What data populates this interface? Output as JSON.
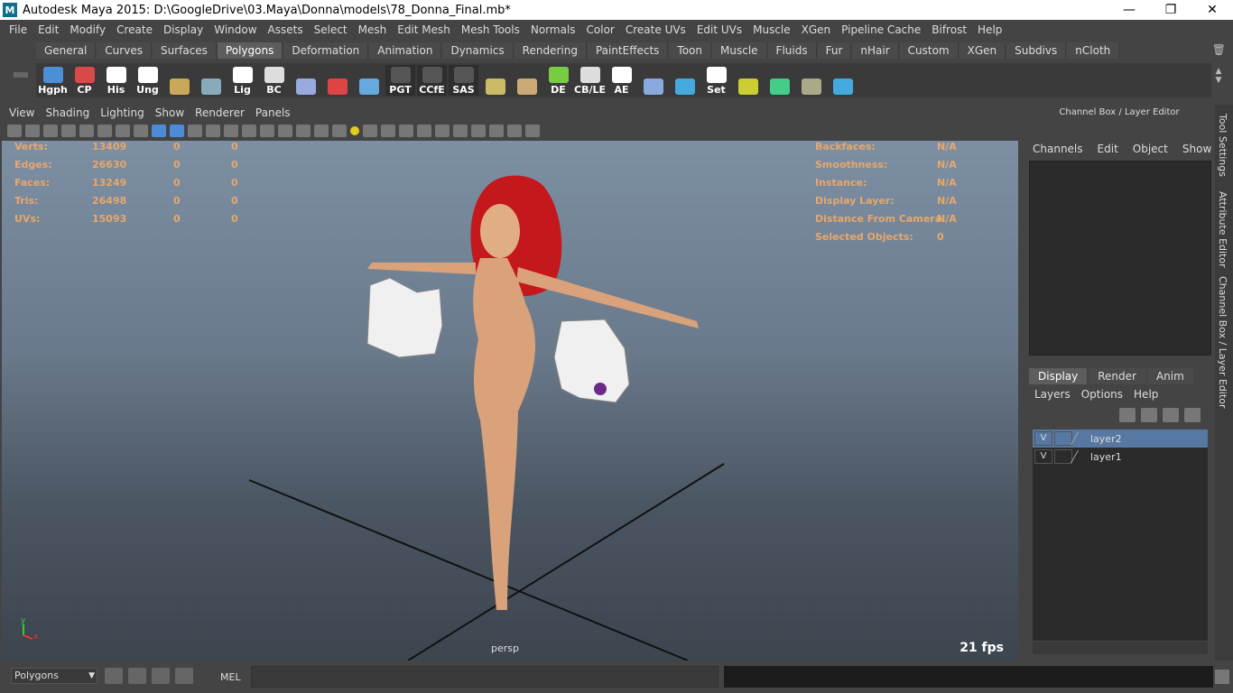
{
  "window": {
    "title": "Autodesk Maya 2015: D:\\GoogleDrive\\03.Maya\\Donna\\models\\78_Donna_Final.mb*",
    "logo": "M"
  },
  "menubar": [
    "File",
    "Edit",
    "Modify",
    "Create",
    "Display",
    "Window",
    "Assets",
    "Select",
    "Mesh",
    "Edit Mesh",
    "Mesh Tools",
    "Normals",
    "Color",
    "Create UVs",
    "Edit UVs",
    "Muscle",
    "XGen",
    "Pipeline Cache",
    "Bifrost",
    "Help"
  ],
  "shelf_tabs": [
    "General",
    "Curves",
    "Surfaces",
    "Polygons",
    "Deformation",
    "Animation",
    "Dynamics",
    "Rendering",
    "PaintEffects",
    "Toon",
    "Muscle",
    "Fluids",
    "Fur",
    "nHair",
    "Custom",
    "XGen",
    "Subdivs",
    "nCloth"
  ],
  "shelf_active": "Polygons",
  "shelf_icons": [
    "Hgph",
    "CP",
    "His",
    "Ung",
    "",
    "",
    "Lig",
    "BC",
    "",
    "",
    "",
    "PGT",
    "CCfE",
    "SAS",
    "",
    "",
    "DE",
    "CB/LE",
    "AE",
    "",
    "",
    "Set",
    "",
    "",
    "",
    ""
  ],
  "viewport_menu": [
    "View",
    "Shading",
    "Lighting",
    "Show",
    "Renderer",
    "Panels"
  ],
  "hud_left": [
    {
      "label": "Verts:",
      "a": "13409",
      "b": "0",
      "c": "0"
    },
    {
      "label": "Edges:",
      "a": "26630",
      "b": "0",
      "c": "0"
    },
    {
      "label": "Faces:",
      "a": "13249",
      "b": "0",
      "c": "0"
    },
    {
      "label": "Tris:",
      "a": "26498",
      "b": "0",
      "c": "0"
    },
    {
      "label": "UVs:",
      "a": "15093",
      "b": "0",
      "c": "0"
    }
  ],
  "hud_right": [
    {
      "label": "Backfaces:",
      "v": "N/A"
    },
    {
      "label": "Smoothness:",
      "v": "N/A"
    },
    {
      "label": "Instance:",
      "v": "N/A"
    },
    {
      "label": "Display Layer:",
      "v": "N/A"
    },
    {
      "label": "Distance From Camera:",
      "v": "N/A"
    },
    {
      "label": "Selected Objects:",
      "v": "0"
    }
  ],
  "camera": "persp",
  "fps": "21 fps",
  "channel_box": {
    "title": "Channel Box / Layer Editor",
    "menu": [
      "Channels",
      "Edit",
      "Object",
      "Show"
    ]
  },
  "layer_tabs": [
    "Display",
    "Render",
    "Anim"
  ],
  "layer_menu": [
    "Layers",
    "Options",
    "Help"
  ],
  "layers": [
    {
      "v": "V",
      "name": "layer2",
      "selected": true
    },
    {
      "v": "V",
      "name": "layer1",
      "selected": false
    }
  ],
  "side_tabs": [
    "Tool Settings",
    "Attribute Editor",
    "Channel Box / Layer Editor"
  ],
  "bottom": {
    "mode": "Polygons",
    "mel": "MEL"
  },
  "axis": {
    "y": "y",
    "x": "x"
  }
}
